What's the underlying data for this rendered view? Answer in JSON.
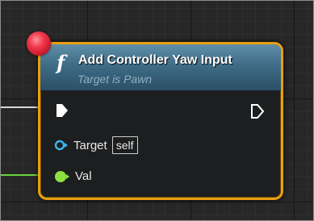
{
  "node": {
    "title": "Add Controller Yaw Input",
    "subtitle": "Target is Pawn",
    "function_icon": "f",
    "border_color": "#e8a010",
    "header_color": "#3f6c86"
  },
  "pins": {
    "exec_in_icon": "exec-pin-filled-icon",
    "exec_out_icon": "exec-pin-outline-icon",
    "target": {
      "label": "Target",
      "default_value": "self",
      "pin_color": "#3ab4ea"
    },
    "val": {
      "label": "Val",
      "pin_color": "#8ee040"
    }
  },
  "wires": {
    "exec_color": "#d8d8d8",
    "float_color": "#67d43a"
  },
  "status": {
    "icon": "error-dot-icon",
    "color": "#e8283c"
  }
}
